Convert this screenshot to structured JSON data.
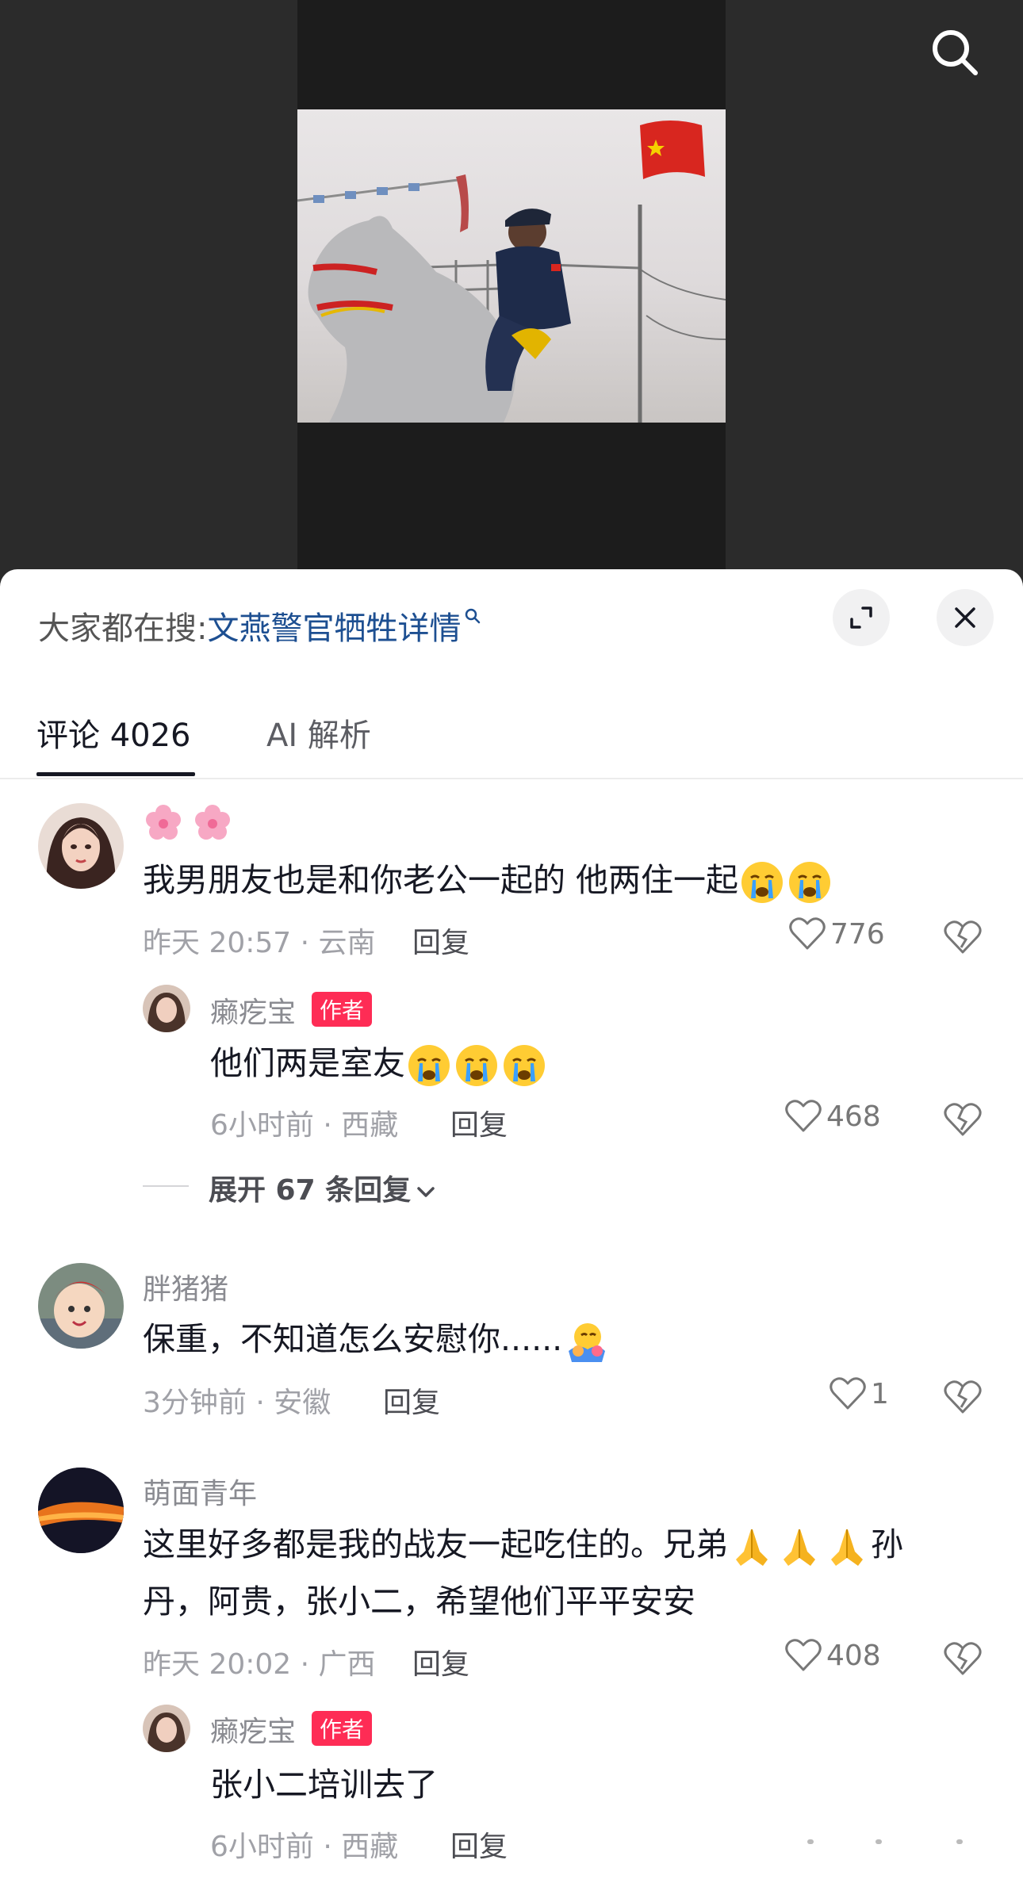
{
  "search_banner": {
    "prefix": "大家都在搜:",
    "keyword": "文燕警官牺牲详情"
  },
  "tabs": [
    {
      "label": "评论 4026",
      "active": true
    },
    {
      "label": "AI 解析",
      "active": false
    }
  ],
  "comments": [
    {
      "user": "",
      "text": "我男朋友也是和你老公一起的 他两住一起",
      "meta": "昨天 20:57 · 云南",
      "reply_label": "回复",
      "likes": "776",
      "replies": [
        {
          "user": "癞疙宝",
          "badge": "作者",
          "text": "他们两是室友",
          "meta": "6小时前 · 西藏",
          "reply_label": "回复",
          "likes": "468"
        }
      ],
      "expand_label": "展开 67 条回复"
    },
    {
      "user": "胖猪猪",
      "text": "保重，不知道怎么安慰你......",
      "meta": "3分钟前 · 安徽",
      "reply_label": "回复",
      "likes": "1"
    },
    {
      "user": "萌面青年",
      "text_line1": "这里好多都是我的战友一起吃住的。兄弟",
      "text_line1_tail": "孙",
      "text_line2": "丹，阿贵，张小二，希望他们平平安安",
      "meta": "昨天 20:02 · 广西",
      "reply_label": "回复",
      "likes": "408",
      "replies": [
        {
          "user": "癞疙宝",
          "badge": "作者",
          "text": "张小二培训去了",
          "meta": "6小时前 · 西藏",
          "reply_label": "回复"
        }
      ]
    }
  ],
  "icons": [
    "search-icon",
    "magnifier-small-icon",
    "expand-icon",
    "close-icon",
    "heart-icon",
    "broken-heart-icon",
    "chevron-down-icon",
    "crying-emoji-icon",
    "praying-hands-emoji-icon",
    "hug-emoji-icon",
    "cherry-blossom-emoji-icon"
  ],
  "colors": {
    "accent_red": "#fe2c55",
    "link_blue": "#1d4f91",
    "text_dark": "#161823",
    "text_muted": "#a0a1a7"
  }
}
